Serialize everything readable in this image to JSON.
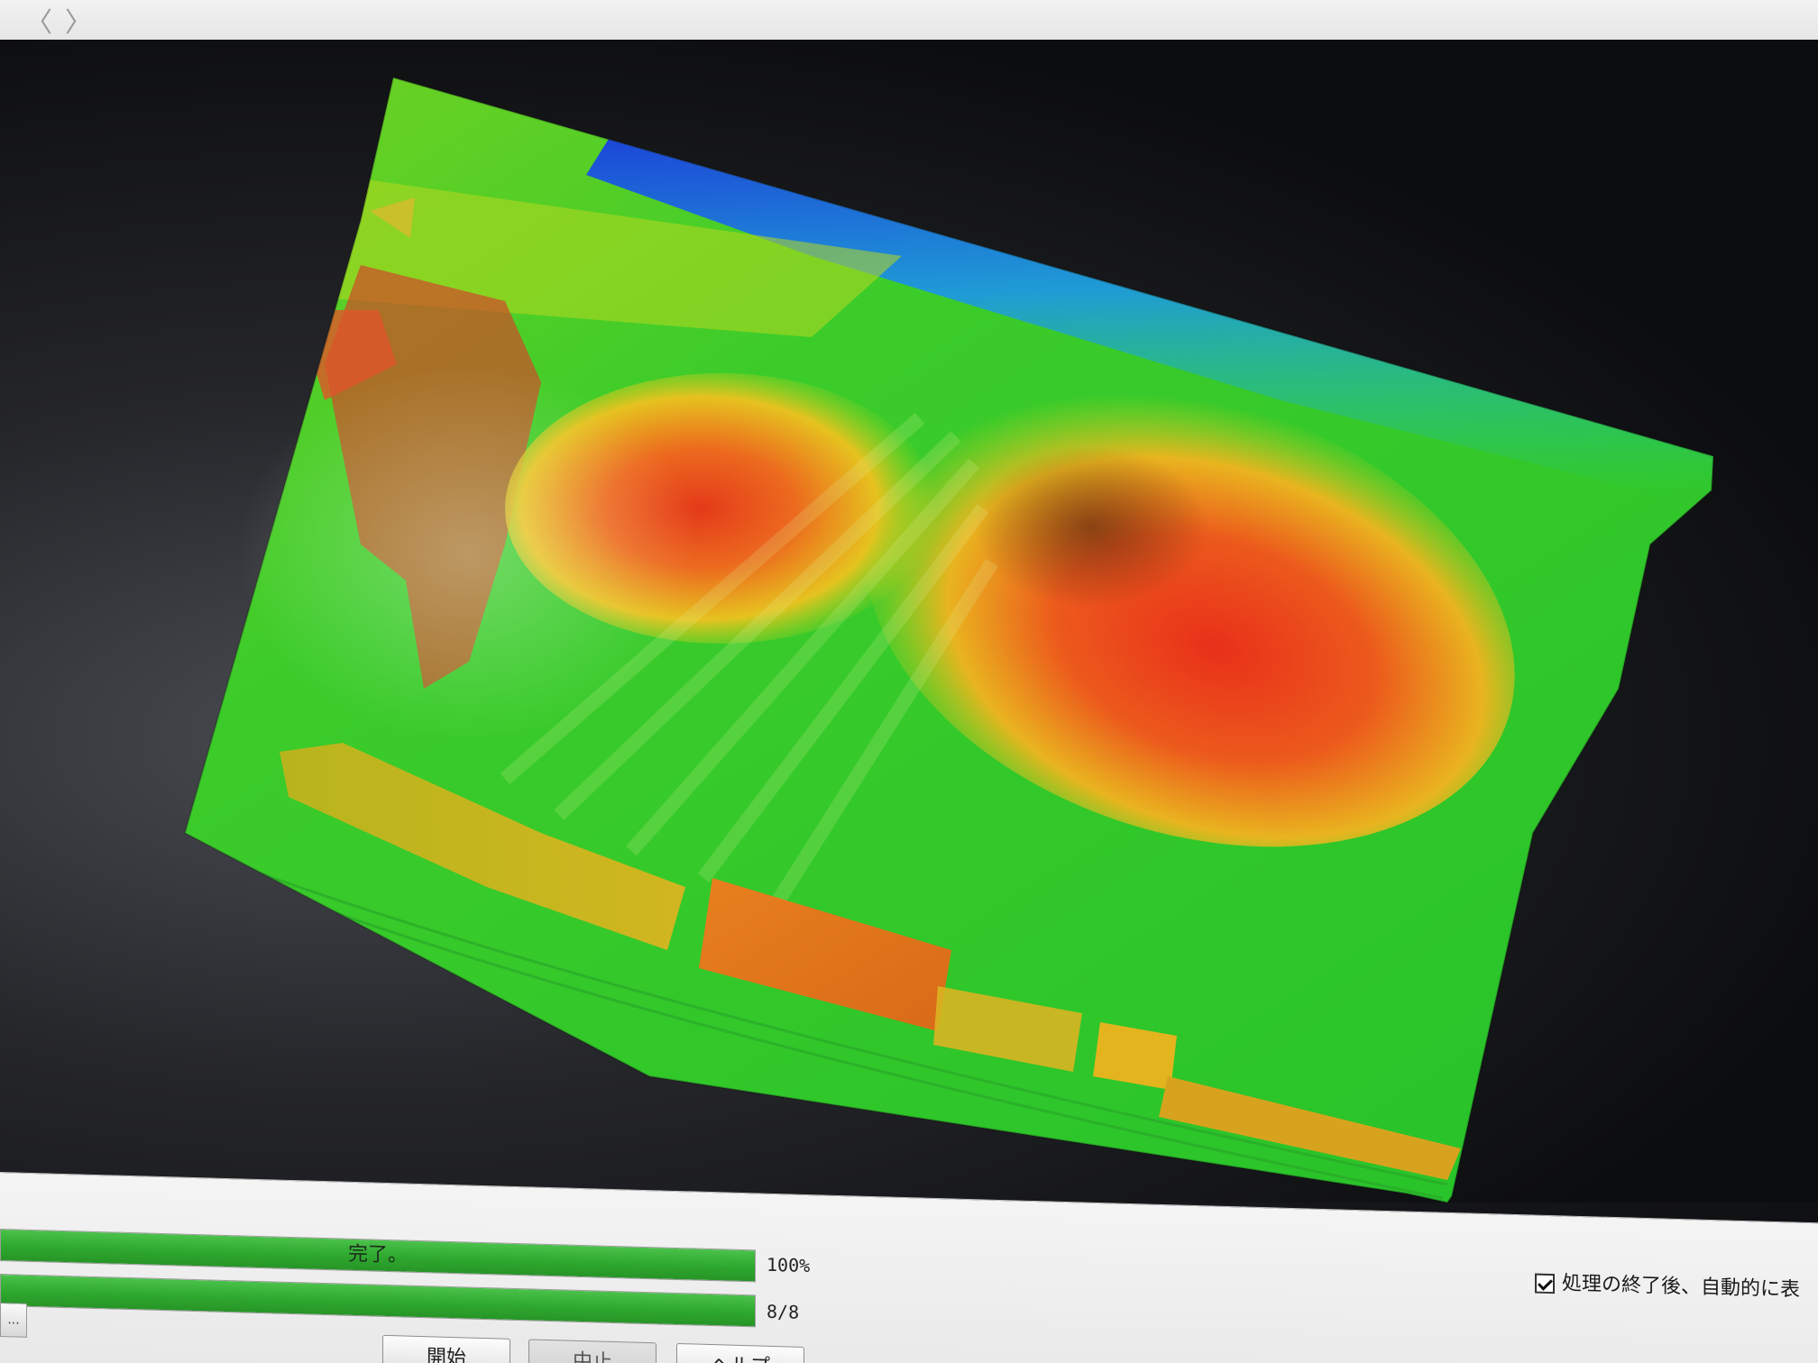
{
  "window": {
    "nav_back_glyph": "〈",
    "nav_forward_glyph": "〉"
  },
  "viewer": {
    "colormap": [
      "#1c3fd8",
      "#1f9bd6",
      "#21c9a6",
      "#2fcc2f",
      "#7fd321",
      "#e2d21f",
      "#f0a01f",
      "#e8441c",
      "#c2231c"
    ],
    "background": "#0d0e10"
  },
  "progress": {
    "overall": {
      "label": "完了。",
      "percent": 100,
      "readout": "100%"
    },
    "steps": {
      "label": "",
      "current": 8,
      "total": 8,
      "readout": "8/8"
    }
  },
  "buttons": {
    "start": "開始",
    "stop": "中止",
    "help": "ヘルプ",
    "ellipsis": "..."
  },
  "options": {
    "auto_display_checkbox_label": "処理の終了後、自動的に表",
    "auto_display_checked": true
  }
}
